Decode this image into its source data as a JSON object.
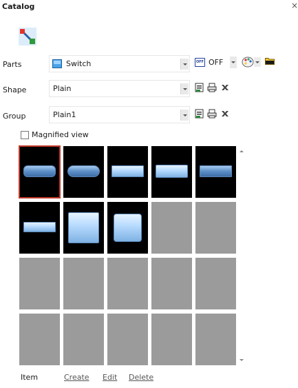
{
  "panel": {
    "title": "Catalog",
    "close_glyph": "×"
  },
  "toolbar": {
    "tool_icon": "shape-tool-icon"
  },
  "parts": {
    "label": "Parts",
    "value": "Switch",
    "item_icon": "switch-part-icon",
    "state_icon_text": "OFF",
    "state_value": "OFF",
    "palette_icon": "palette-icon",
    "folder_icon": "folder-icon"
  },
  "shape": {
    "label": "Shape",
    "value": "Plain"
  },
  "group": {
    "label": "Group",
    "value": "Plain1"
  },
  "magnified": {
    "label": "Magnified view",
    "checked": false
  },
  "grid": {
    "columns": 5,
    "rows": 4,
    "selected_index": 0,
    "cells": [
      "rounded-bar",
      "pill-bar",
      "flat-bar",
      "light-bar",
      "flat-bar-dark",
      "small-flat-bar",
      "large-square",
      "medium-square",
      "empty",
      "empty",
      "empty",
      "empty",
      "empty",
      "empty",
      "empty",
      "empty",
      "empty",
      "empty",
      "empty",
      "empty"
    ]
  },
  "footer": {
    "item_label": "Item",
    "create_label": "Create",
    "edit_label": "Edit",
    "delete_label": "Delete"
  }
}
